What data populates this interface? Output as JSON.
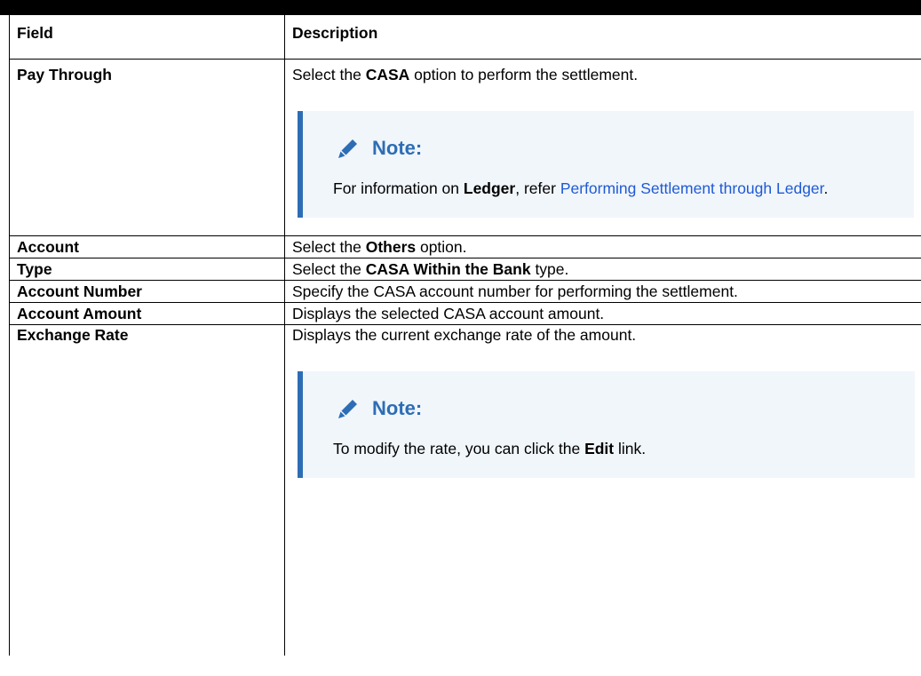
{
  "table": {
    "headers": {
      "field": "Field",
      "description": "Description"
    },
    "rows": [
      {
        "field": "Pay Through",
        "desc_pre": "Select the ",
        "desc_bold": "CASA",
        "desc_post": " option to perform the settlement.",
        "note": {
          "title": "Note:",
          "text_pre": "For information on ",
          "text_bold": "Ledger",
          "text_mid": ", refer ",
          "link_text": "Performing Settlement through Ledger",
          "text_post": "."
        }
      },
      {
        "field": "Account",
        "desc_pre": "Select the ",
        "desc_bold": "Others",
        "desc_post": " option."
      },
      {
        "field": "Type",
        "desc_pre": "Select the ",
        "desc_bold": "CASA Within the Bank",
        "desc_post": " type."
      },
      {
        "field": "Account Number",
        "desc": "Specify the CASA account number for performing the settlement."
      },
      {
        "field": "Account Amount",
        "desc": "Displays the selected CASA account amount."
      },
      {
        "field": "Exchange Rate",
        "desc": "Displays the current exchange rate of the amount.",
        "note": {
          "title": "Note:",
          "text_pre": "To modify the rate, you can click the ",
          "text_bold": "Edit",
          "text_post": " link."
        }
      }
    ]
  },
  "colors": {
    "note_accent": "#2d6db5",
    "note_background": "#f1f6fb",
    "link": "#1f5ad3"
  },
  "icons": {
    "note": "pencil-icon"
  }
}
